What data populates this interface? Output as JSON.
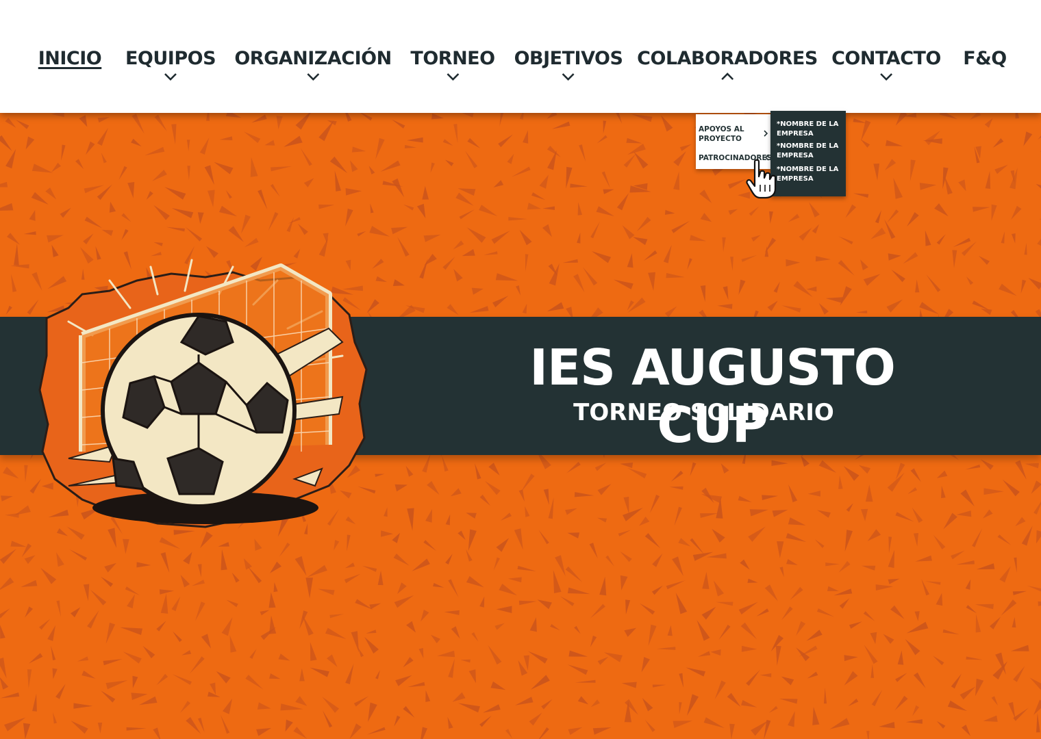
{
  "nav": {
    "items": [
      {
        "label": "INICIO",
        "active": true
      },
      {
        "label": "EQUIPOS"
      },
      {
        "label": "ORGANIZACIÓN"
      },
      {
        "label": "TORNEO"
      },
      {
        "label": "OBJETIVOS"
      },
      {
        "label": "COLABORADORES",
        "expanded": true
      },
      {
        "label": "CONTACTO"
      },
      {
        "label": "F&Q"
      }
    ]
  },
  "dropdown": {
    "apoyos_line1": "APOYOS AL",
    "apoyos_line2": "PROYECTO",
    "patrocinadores": "PATROCINADORES",
    "sponsors": [
      {
        "line1": "*NOMBRE DE LA",
        "line2": "EMPRESA"
      },
      {
        "line1": "*NOMBRE DE LA",
        "line2": "EMPRESA"
      },
      {
        "line1": "*NOMBRE DE LA",
        "line2": "EMPRESA"
      }
    ]
  },
  "hero": {
    "title": "IES AUGUSTO CUP",
    "subtitle": "TORNEO SOLIDARIO"
  },
  "colors": {
    "background": "#ee6a12",
    "pattern": "#c9531c",
    "banner": "#233234",
    "nav_text": "#1f2b30"
  },
  "icons": {
    "nav_arrow": "chevron-down-icon",
    "nav_arrow_open": "chevron-up-icon",
    "submenu_open": "chevron-right-icon",
    "submenu_close": "chevron-left-icon",
    "cursor": "hand-pointer-icon",
    "logo": "soccer-ball-goal-logo"
  }
}
